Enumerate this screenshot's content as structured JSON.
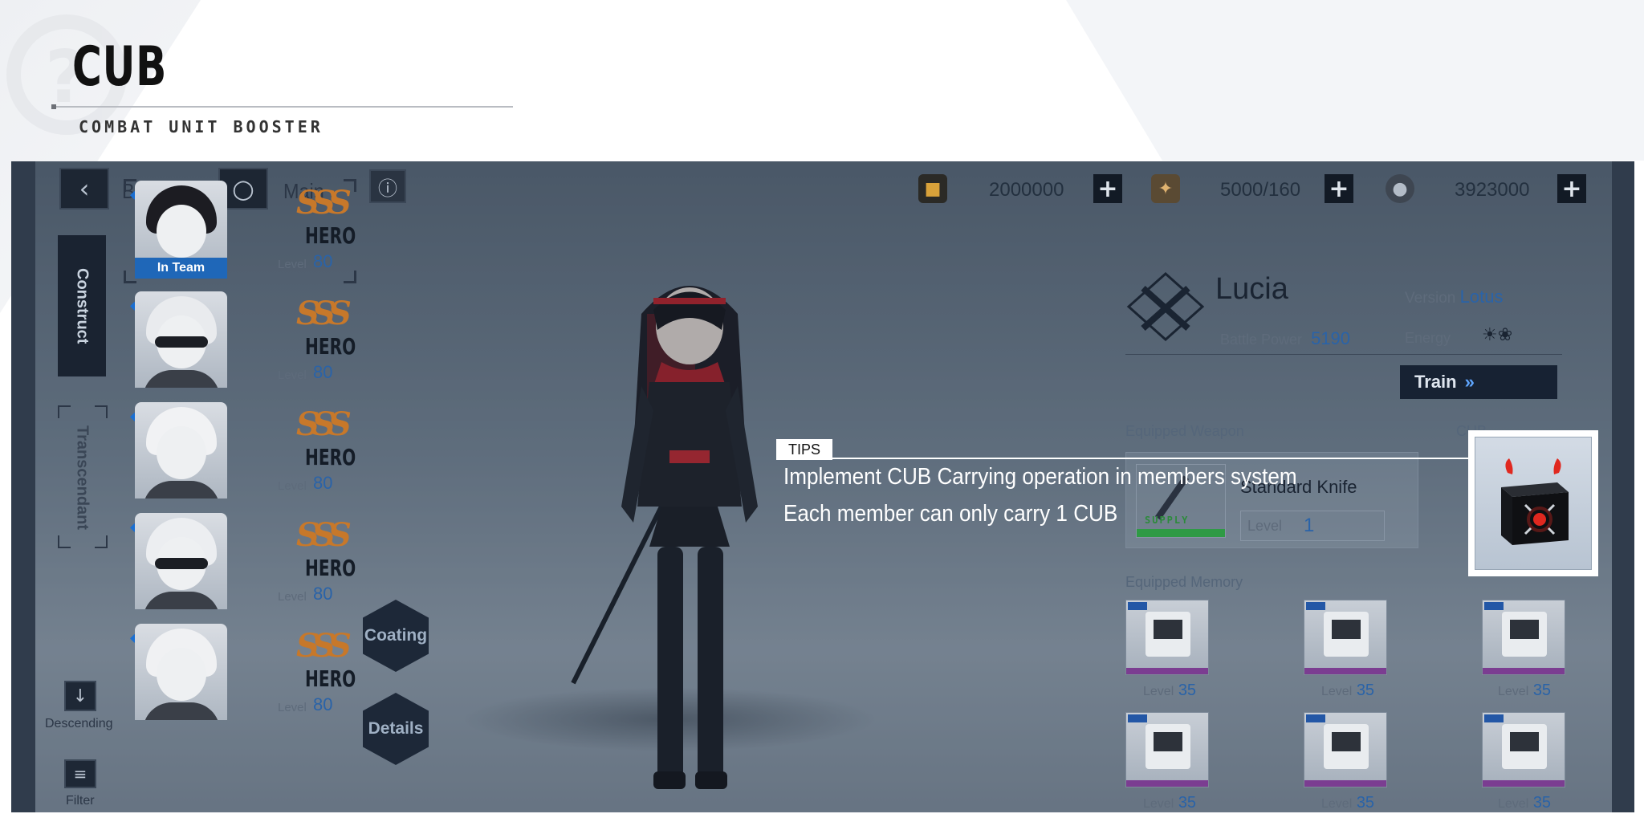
{
  "slide": {
    "title": "CUB",
    "subtitle": "COMBAT UNIT BOOSTER"
  },
  "topbar": {
    "back_label": "Back",
    "main_label": "Main",
    "resources": [
      {
        "icon": "ticket-icon",
        "value": "2000000"
      },
      {
        "icon": "serum-icon",
        "value": "5000/160"
      },
      {
        "icon": "coin-icon",
        "value": "3923000"
      }
    ]
  },
  "sidebar": {
    "construct_label": "Construct",
    "transcendant_label": "Transcendant",
    "descending_label": "Descending",
    "filter_label": "Filter"
  },
  "roster": [
    {
      "badge": "In Team",
      "rank": "SSS",
      "class": "HERO",
      "level_label": "Level",
      "level": "80",
      "hair": "#1c1c22",
      "visor": false
    },
    {
      "rank": "SSS",
      "class": "HERO",
      "level_label": "Level",
      "level": "80",
      "hair": "#e9ebee",
      "visor": true
    },
    {
      "rank": "SSS",
      "class": "HERO",
      "level_label": "Level",
      "level": "80",
      "hair": "#f1f2f4",
      "visor": false
    },
    {
      "rank": "SSS",
      "class": "HERO",
      "level_label": "Level",
      "level": "80",
      "hair": "#eceef1",
      "visor": true
    },
    {
      "rank": "SSS",
      "class": "HERO",
      "level_label": "Level",
      "level": "80",
      "hair": "#f0f1f3",
      "visor": false
    }
  ],
  "actions": {
    "coating_label": "Coating",
    "details_label": "Details"
  },
  "character": {
    "name": "Lucia",
    "version_label": "Version",
    "version": "Lotus",
    "battle_power_label": "Battle Power",
    "battle_power": "5190",
    "energy_label": "Energy",
    "train_label": "Train"
  },
  "weapon": {
    "section_label": "Equipped Weapon",
    "cub_label": "CUB",
    "name": "Standard Knife",
    "level_label": "Level",
    "level": "1",
    "rarity": "SUPPLY"
  },
  "memory": {
    "section_label": "Equipped Memory",
    "items": [
      {
        "level_label": "Level",
        "level": "35"
      },
      {
        "level_label": "Level",
        "level": "35"
      },
      {
        "level_label": "Level",
        "level": "35"
      },
      {
        "level_label": "Level",
        "level": "35"
      },
      {
        "level_label": "Level",
        "level": "35"
      },
      {
        "level_label": "Level",
        "level": "35"
      }
    ]
  },
  "tips": {
    "tag": "TIPS",
    "line1": "Implement CUB Carrying operation in members system",
    "line2": "Each member can only carry 1 CUB"
  },
  "colors": {
    "accent_blue": "#2a63a8",
    "rank_gold": "#c7782a",
    "in_team_blue": "#1f67b8",
    "cub_red": "#e0281f"
  }
}
